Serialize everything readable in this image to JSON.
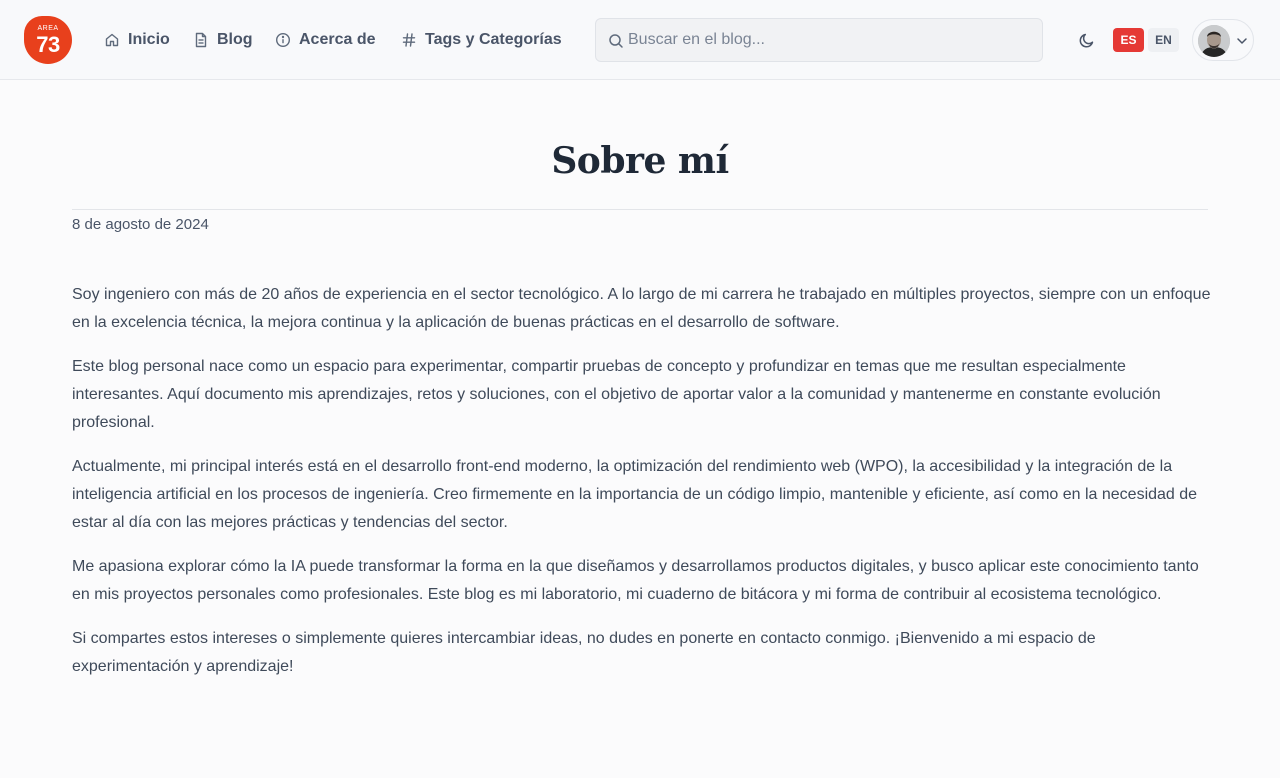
{
  "header": {
    "logo": {
      "top_text": "AREA",
      "number": "73",
      "color": "#e8401c"
    },
    "nav": [
      {
        "label": "Inicio",
        "icon": "home-icon"
      },
      {
        "label": "Blog",
        "icon": "document-icon"
      },
      {
        "label": "Acerca de",
        "icon": "info-icon"
      },
      {
        "label": "Tags y Categorías",
        "icon": "hash-icon"
      }
    ],
    "search": {
      "placeholder": "Buscar en el blog...",
      "value": ""
    },
    "theme_icon": "moon-icon",
    "languages": [
      {
        "code": "ES",
        "active": true,
        "color": "#e53935"
      },
      {
        "code": "EN",
        "active": false
      }
    ],
    "user_menu": {
      "avatar": "avatar-photo",
      "icon": "chevron-down-icon"
    }
  },
  "page": {
    "title": "Sobre mí",
    "date": "8 de agosto de 2024",
    "paragraphs": [
      "Soy ingeniero con más de 20 años de experiencia en el sector tecnológico. A lo largo de mi carrera he trabajado en múltiples proyectos, siempre con un enfoque en la excelencia técnica, la mejora continua y la aplicación de buenas prácticas en el desarrollo de software.",
      "Este blog personal nace como un espacio para experimentar, compartir pruebas de concepto y profundizar en temas que me resultan especialmente interesantes. Aquí documento mis aprendizajes, retos y soluciones, con el objetivo de aportar valor a la comunidad y mantenerme en constante evolución profesional.",
      "Actualmente, mi principal interés está en el desarrollo front-end moderno, la optimización del rendimiento web (WPO), la accesibilidad y la integración de la inteligencia artificial en los procesos de ingeniería. Creo firmemente en la importancia de un código limpio, mantenible y eficiente, así como en la necesidad de estar al día con las mejores prácticas y tendencias del sector.",
      "Me apasiona explorar cómo la IA puede transformar la forma en la que diseñamos y desarrollamos productos digitales, y busco aplicar este conocimiento tanto en mis proyectos personales como profesionales. Este blog es mi laboratorio, mi cuaderno de bitácora y mi forma de contribuir al ecosistema tecnológico.",
      "Si compartes estos intereses o simplemente quieres intercambiar ideas, no dudes en ponerte en contacto conmigo. ¡Bienvenido a mi espacio de experimentación y aprendizaje!"
    ]
  }
}
